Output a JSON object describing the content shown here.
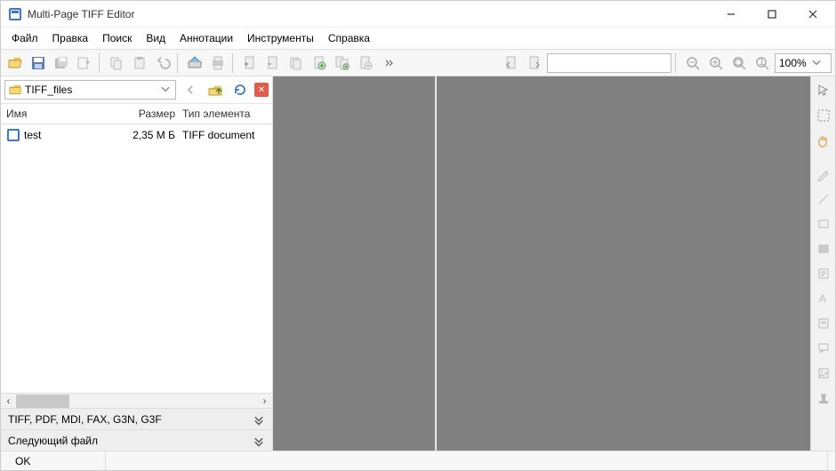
{
  "window": {
    "title": "Multi-Page TIFF Editor"
  },
  "menu": [
    "Файл",
    "Правка",
    "Поиск",
    "Вид",
    "Аннотации",
    "Инструменты",
    "Справка"
  ],
  "nav": {
    "path": "TIFF_files"
  },
  "filelist": {
    "headers": {
      "name": "Имя",
      "size": "Размер",
      "type": "Тип элемента"
    },
    "rows": [
      {
        "name": "test",
        "size": "2,35 М Б",
        "type": "TIFF document"
      }
    ]
  },
  "filter": {
    "label": "TIFF, PDF, MDI, FAX, G3N, G3F"
  },
  "nextfile": {
    "label": "Следующий файл"
  },
  "zoom": {
    "value": "100%"
  },
  "status": {
    "ok": "OK"
  },
  "colors": {
    "toolbar": "#f7f7f7",
    "canvas": "#808080"
  }
}
